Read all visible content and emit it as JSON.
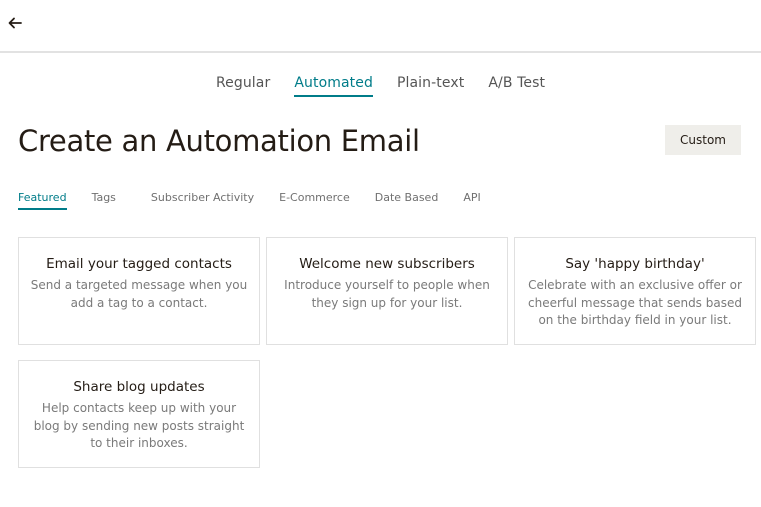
{
  "header": {
    "back_icon": "arrow-left-icon"
  },
  "type_tabs": [
    {
      "label": "Regular",
      "active": false
    },
    {
      "label": "Automated",
      "active": true
    },
    {
      "label": "Plain-text",
      "active": false
    },
    {
      "label": "A/B Test",
      "active": false
    }
  ],
  "page": {
    "title": "Create an Automation Email",
    "custom_button_label": "Custom"
  },
  "category_tabs": [
    {
      "label": "Featured",
      "active": true
    },
    {
      "label": "Tags",
      "active": false
    },
    {
      "label": "Subscriber Activity",
      "active": false
    },
    {
      "label": "E-Commerce",
      "active": false
    },
    {
      "label": "Date Based",
      "active": false
    },
    {
      "label": "API",
      "active": false
    }
  ],
  "cards": [
    {
      "title": "Email your tagged contacts",
      "description": "Send a targeted message when you add a tag to a contact."
    },
    {
      "title": "Welcome new subscribers",
      "description": "Introduce yourself to people when they sign up for your list."
    },
    {
      "title": "Say 'happy birthday'",
      "description": "Celebrate with an exclusive offer or cheerful message that sends based on the birthday field in your list."
    },
    {
      "title": "Share blog updates",
      "description": "Help contacts keep up with your blog by sending new posts straight to their inboxes."
    }
  ],
  "colors": {
    "accent": "#007c89",
    "button_bg": "#efeeea",
    "divider": "#e2e2e2"
  }
}
